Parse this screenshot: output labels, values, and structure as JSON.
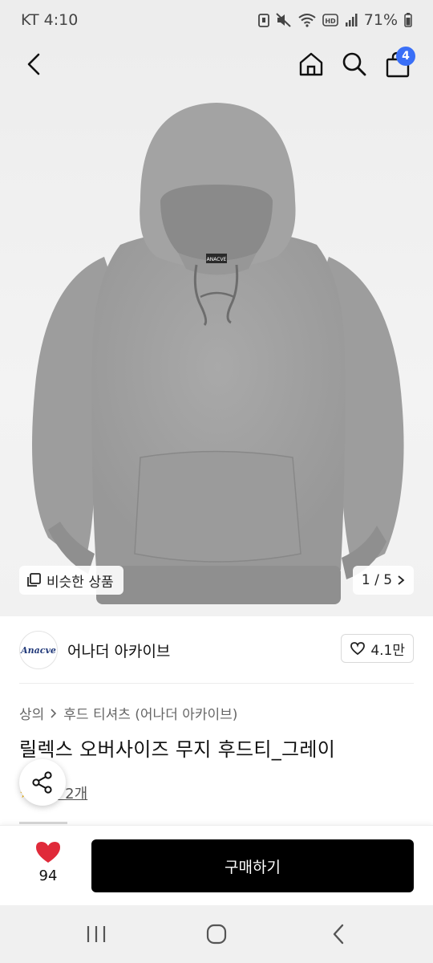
{
  "status_bar": {
    "carrier_time": "KT 4:10",
    "battery": "71%"
  },
  "top_nav": {
    "cart_badge": "4"
  },
  "hero": {
    "similar_label": "비슷한 상품",
    "pager": "1 / 5",
    "neck_label": "ANACVE"
  },
  "shop": {
    "logo_text": "Anacve",
    "name": "어나더 아카이브",
    "likes": "4.1만"
  },
  "breadcrumb": {
    "category": "상의",
    "subcategory": "후드 티셔츠 (어나더 아카이브)"
  },
  "product": {
    "title": "릴렉스 오버사이즈 무지 후드티_그레이",
    "review_text": "후기 2개"
  },
  "bottom_bar": {
    "like_count": "94",
    "buy_label": "구매하기"
  },
  "icons": {
    "back": "chevron-left-icon",
    "home": "home-icon",
    "search": "search-icon",
    "cart": "shopping-bag-icon",
    "share": "share-icon",
    "heart": "heart-icon",
    "accent_heart": "#e02a3a",
    "badge_color": "#3a6ff7"
  }
}
